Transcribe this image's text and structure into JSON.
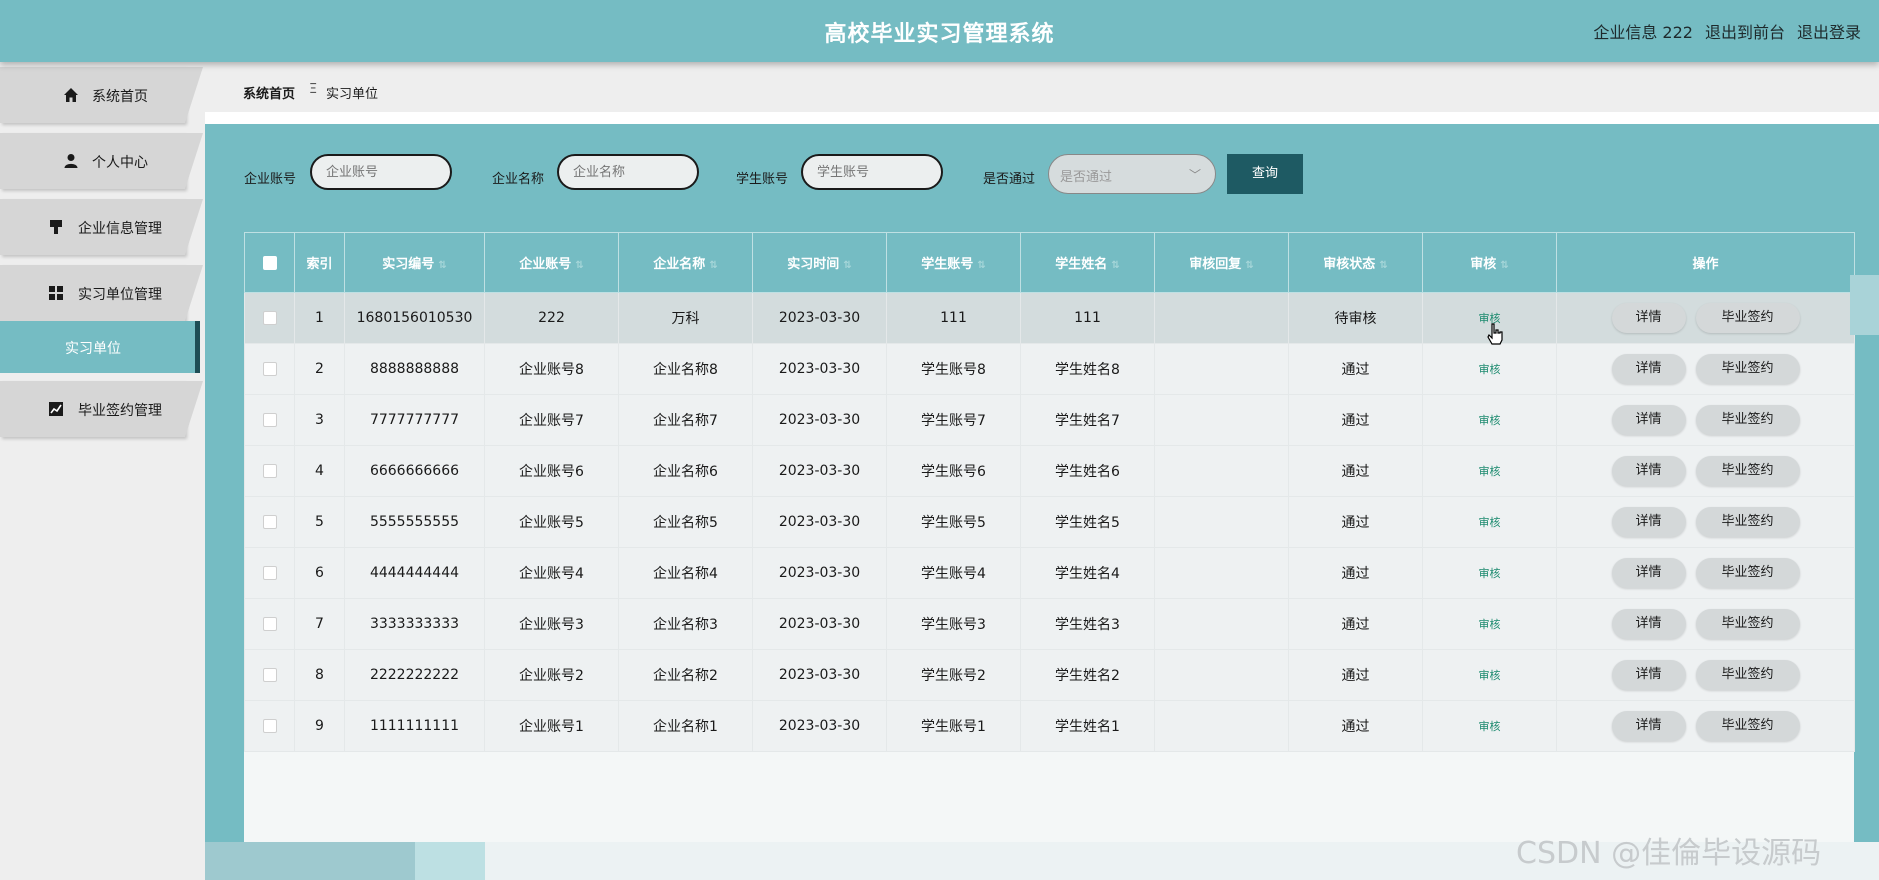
{
  "header": {
    "title": "高校毕业实习管理系统",
    "links": [
      "企业信息 222",
      "退出到前台",
      "退出登录"
    ]
  },
  "sidebar": {
    "items": [
      {
        "label": "系统首页",
        "icon": "home-icon"
      },
      {
        "label": "个人中心",
        "icon": "user-icon"
      },
      {
        "label": "企业信息管理",
        "icon": "brush-icon"
      },
      {
        "label": "实习单位管理",
        "icon": "grid-icon"
      },
      {
        "label": "实习单位",
        "icon": "",
        "active": true
      },
      {
        "label": "毕业签约管理",
        "icon": "chart-icon"
      }
    ]
  },
  "breadcrumb": {
    "home": "系统首页",
    "separator": "Ξ",
    "current": "实习单位"
  },
  "search": {
    "company_account_label": "企业账号",
    "company_account_placeholder": "企业账号",
    "company_name_label": "企业名称",
    "company_name_placeholder": "企业名称",
    "student_account_label": "学生账号",
    "student_account_placeholder": "学生账号",
    "passed_label": "是否通过",
    "passed_placeholder": "是否通过",
    "query_button": "查询"
  },
  "table": {
    "columns": [
      "索引",
      "实习编号",
      "企业账号",
      "企业名称",
      "实习时间",
      "学生账号",
      "学生姓名",
      "审核回复",
      "审核状态",
      "审核",
      "操作"
    ],
    "audit_label": "审核",
    "detail_label": "详情",
    "sign_label": "毕业签约",
    "rows": [
      {
        "index": "1",
        "no": "1680156010530",
        "company_account": "222",
        "company_name": "万科",
        "date": "2023-03-30",
        "student_account": "111",
        "student_name": "111",
        "reply": "",
        "status": "待审核"
      },
      {
        "index": "2",
        "no": "8888888888",
        "company_account": "企业账号8",
        "company_name": "企业名称8",
        "date": "2023-03-30",
        "student_account": "学生账号8",
        "student_name": "学生姓名8",
        "reply": "",
        "status": "通过"
      },
      {
        "index": "3",
        "no": "7777777777",
        "company_account": "企业账号7",
        "company_name": "企业名称7",
        "date": "2023-03-30",
        "student_account": "学生账号7",
        "student_name": "学生姓名7",
        "reply": "",
        "status": "通过"
      },
      {
        "index": "4",
        "no": "6666666666",
        "company_account": "企业账号6",
        "company_name": "企业名称6",
        "date": "2023-03-30",
        "student_account": "学生账号6",
        "student_name": "学生姓名6",
        "reply": "",
        "status": "通过"
      },
      {
        "index": "5",
        "no": "5555555555",
        "company_account": "企业账号5",
        "company_name": "企业名称5",
        "date": "2023-03-30",
        "student_account": "学生账号5",
        "student_name": "学生姓名5",
        "reply": "",
        "status": "通过"
      },
      {
        "index": "6",
        "no": "4444444444",
        "company_account": "企业账号4",
        "company_name": "企业名称4",
        "date": "2023-03-30",
        "student_account": "学生账号4",
        "student_name": "学生姓名4",
        "reply": "",
        "status": "通过"
      },
      {
        "index": "7",
        "no": "3333333333",
        "company_account": "企业账号3",
        "company_name": "企业名称3",
        "date": "2023-03-30",
        "student_account": "学生账号3",
        "student_name": "学生姓名3",
        "reply": "",
        "status": "通过"
      },
      {
        "index": "8",
        "no": "2222222222",
        "company_account": "企业账号2",
        "company_name": "企业名称2",
        "date": "2023-03-30",
        "student_account": "学生账号2",
        "student_name": "学生姓名2",
        "reply": "",
        "status": "通过"
      },
      {
        "index": "9",
        "no": "1111111111",
        "company_account": "企业账号1",
        "company_name": "企业名称1",
        "date": "2023-03-30",
        "student_account": "学生账号1",
        "student_name": "学生姓名1",
        "reply": "",
        "status": "通过"
      }
    ]
  },
  "watermark": "CSDN @佳倫毕设源码",
  "colors": {
    "primary": "#75bcc3",
    "dark": "#1e5a63",
    "audit_link": "#1b8a6e"
  }
}
